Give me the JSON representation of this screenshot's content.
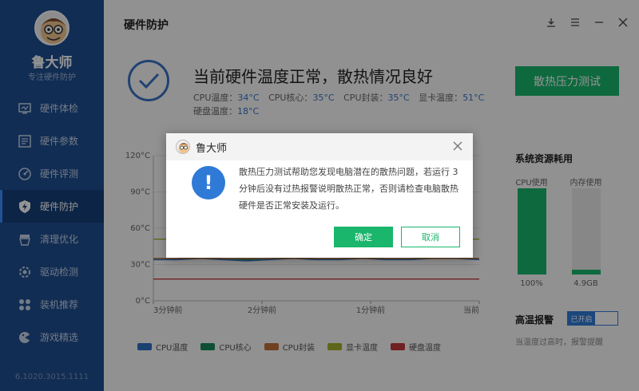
{
  "app": {
    "name": "鲁大师",
    "slogan": "专注硬件防护",
    "version": "6.1020.3015.1111"
  },
  "sidebar": {
    "items": [
      {
        "label": "硬件体检",
        "icon": "monitor-icon"
      },
      {
        "label": "硬件参数",
        "icon": "list-icon"
      },
      {
        "label": "硬件评测",
        "icon": "speedometer-icon"
      },
      {
        "label": "硬件防护",
        "icon": "shield-icon",
        "active": true
      },
      {
        "label": "清理优化",
        "icon": "broom-icon"
      },
      {
        "label": "驱动检测",
        "icon": "gear-icon"
      },
      {
        "label": "装机推荐",
        "icon": "puzzle-icon"
      },
      {
        "label": "游戏精选",
        "icon": "gamepad-icon"
      }
    ]
  },
  "header": {
    "title": "硬件防护"
  },
  "status": {
    "title": "当前硬件温度正常，散热情况良好",
    "temps": [
      {
        "label": "CPU温度：",
        "value": "34°C"
      },
      {
        "label": "CPU核心：",
        "value": "35°C"
      },
      {
        "label": "CPU封装：",
        "value": "35°C"
      },
      {
        "label": "显卡温度：",
        "value": "51°C"
      },
      {
        "label": "硬盘温度：",
        "value": "18°C"
      }
    ],
    "stress_button": "散热压力测试"
  },
  "chart_data": {
    "type": "line",
    "x": [
      "3分钟前",
      "2分钟前",
      "1分钟前",
      "当前"
    ],
    "y_ticks": [
      "0°C",
      "30°C",
      "60°C",
      "90°C",
      "120°C"
    ],
    "ylim": [
      0,
      120
    ],
    "series": [
      {
        "name": "CPU温度",
        "color": "#2f6fc4",
        "values": [
          34,
          34,
          35,
          34,
          33,
          34,
          35,
          34,
          34,
          35,
          34,
          34,
          35,
          35,
          34
        ]
      },
      {
        "name": "CPU核心",
        "color": "#1b8a5a",
        "values": [
          35,
          35,
          36,
          35,
          34,
          35,
          36,
          35,
          35,
          36,
          35,
          35,
          36,
          36,
          35
        ]
      },
      {
        "name": "CPU封装",
        "color": "#c2703a",
        "values": [
          35,
          35,
          35,
          35,
          35,
          35,
          35,
          35,
          35,
          35,
          35,
          35,
          35,
          35,
          35
        ]
      },
      {
        "name": "显卡温度",
        "color": "#a3b12b",
        "values": [
          51,
          51,
          51,
          51,
          51,
          51,
          51,
          51,
          51,
          51,
          51,
          51,
          51,
          51,
          51
        ]
      },
      {
        "name": "硬盘温度",
        "color": "#c23a3a",
        "values": [
          18,
          18,
          18,
          18,
          18,
          18,
          18,
          18,
          18,
          18,
          18,
          18,
          18,
          18,
          18
        ]
      }
    ]
  },
  "resources": {
    "title": "系统资源耗用",
    "cpu": {
      "label": "CPU使用",
      "value": "100%",
      "fill": 1.0
    },
    "mem": {
      "label": "内存使用",
      "value": "4.9GB",
      "fill": 0.06
    }
  },
  "alert": {
    "title": "高温报警",
    "toggle_label": "已开启",
    "desc": "当温度过高时，报警提醒"
  },
  "dialog": {
    "title": "鲁大师",
    "message": "散热压力测试帮助您发现电脑潜在的散热问题，若运行 3 分钟后没有过热报警说明散热正常，否则请检查电脑散热硬件是否正常安装及运行。",
    "ok": "确定",
    "cancel": "取消"
  },
  "colors": {
    "sidebar": "#1f4e8f",
    "accent_green": "#19b66c",
    "accent_blue": "#2f7ad6"
  }
}
